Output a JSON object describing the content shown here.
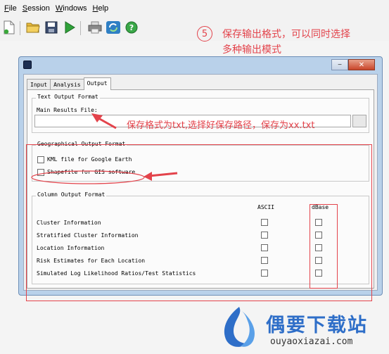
{
  "menu": {
    "file": "File",
    "session": "Session",
    "windows": "Windows",
    "help": "Help"
  },
  "toolbar": {
    "icons": [
      "new-icon",
      "open-folder-icon",
      "save-icon",
      "run-icon",
      "print-icon",
      "refresh-icon",
      "help-icon"
    ]
  },
  "annotation": {
    "step_number": "5",
    "step_line1": "保存输出格式，可以同时选择",
    "step_line2": "多种输出模式",
    "path_note_prefix": "保存格式为",
    "path_note_txt": "txt",
    "path_note_middle": ",选择好保存路径，保存为",
    "path_note_file": "xx.txt"
  },
  "dialog": {
    "minimize": "−",
    "close": "✕",
    "tabs": [
      "Input",
      "Analysis",
      "Output"
    ],
    "active_tab": "Output",
    "text_output": {
      "group_label": "Text Output Format",
      "main_results_label": "Main Results File:",
      "main_results_value": ""
    },
    "geo_output": {
      "group_label": "Geographical Output Format",
      "kml_label": "KML file for Google Earth",
      "kml_checked": false,
      "shapefile_label": "Shapefile for GIS software",
      "shapefile_checked": false
    },
    "column_output": {
      "group_label": "Column Output Format",
      "col_ascii": "ASCII",
      "col_dbase": "dBase",
      "rows": [
        {
          "label": "Cluster Information",
          "ascii": false,
          "dbase": false
        },
        {
          "label": "Stratified Cluster Information",
          "ascii": false,
          "dbase": false
        },
        {
          "label": "Location Information",
          "ascii": false,
          "dbase": false
        },
        {
          "label": "Risk Estimates for Each Location",
          "ascii": false,
          "dbase": false
        },
        {
          "label": "Simulated Log Likelihood Ratios/Test Statistics",
          "ascii": false,
          "dbase": false
        }
      ]
    }
  },
  "watermark": {
    "title": "偶要下载站",
    "url": "ouyaoxiazai.com"
  },
  "colors": {
    "annotation_red": "#e3434b",
    "logo_blue": "#2e6ec8",
    "window_frame": "#b9d1ea"
  }
}
